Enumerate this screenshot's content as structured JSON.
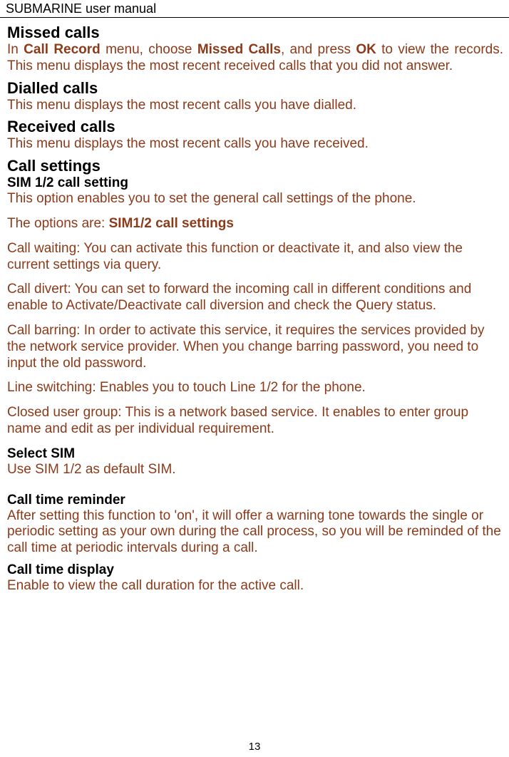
{
  "header": "SUBMARINE user manual",
  "sections": {
    "missed_calls": {
      "title": "Missed calls",
      "text_pre": "In ",
      "bold1": "Call Record",
      "text_mid1": " menu, choose ",
      "bold2": "Missed Calls",
      "text_mid2": ", and press ",
      "bold3": "OK",
      "text_post": " to view the records. This menu displays the most recent received calls that you did not answer."
    },
    "dialled_calls": {
      "title": "Dialled calls",
      "text": "This menu displays the most recent calls you have dialled."
    },
    "received_calls": {
      "title": "Received calls",
      "text": "This menu displays the most recent calls you have received."
    },
    "call_settings": {
      "title": "Call settings",
      "sim_setting_title": "SIM 1/2 call setting",
      "sim_setting_text": "This option enables you to set the general call settings of the phone.",
      "options_pre": "The options are: ",
      "options_bold": "SIM1/2 call settings",
      "call_waiting": "Call waiting: You can activate this function or deactivate it, and also view the current settings via query.",
      "call_divert": "Call divert: You can set to forward the incoming call in different conditions and enable to Activate/Deactivate call diversion and check the Query status.",
      "call_barring": "Call barring: In order to activate this service, it requires the services provided by the network service provider. When you change barring password, you need to input the old password.",
      "line_switching": "Line switching: Enables you to touch Line 1/2 for the phone.",
      "closed_group": "Closed user group: This is a network based service. It enables to enter group name and edit as per individual requirement.",
      "select_sim_title": "Select SIM",
      "select_sim_text": "Use SIM 1/2 as default SIM.",
      "reminder_title": "Call time reminder",
      "reminder_text": "After setting this function to 'on', it will offer a warning tone towards the single or periodic setting as your own during the call process, so you will be reminded of the call time at periodic intervals during a call.",
      "display_title": "Call time display",
      "display_text": "Enable to view the call duration for the active call."
    }
  },
  "page_number": "13"
}
